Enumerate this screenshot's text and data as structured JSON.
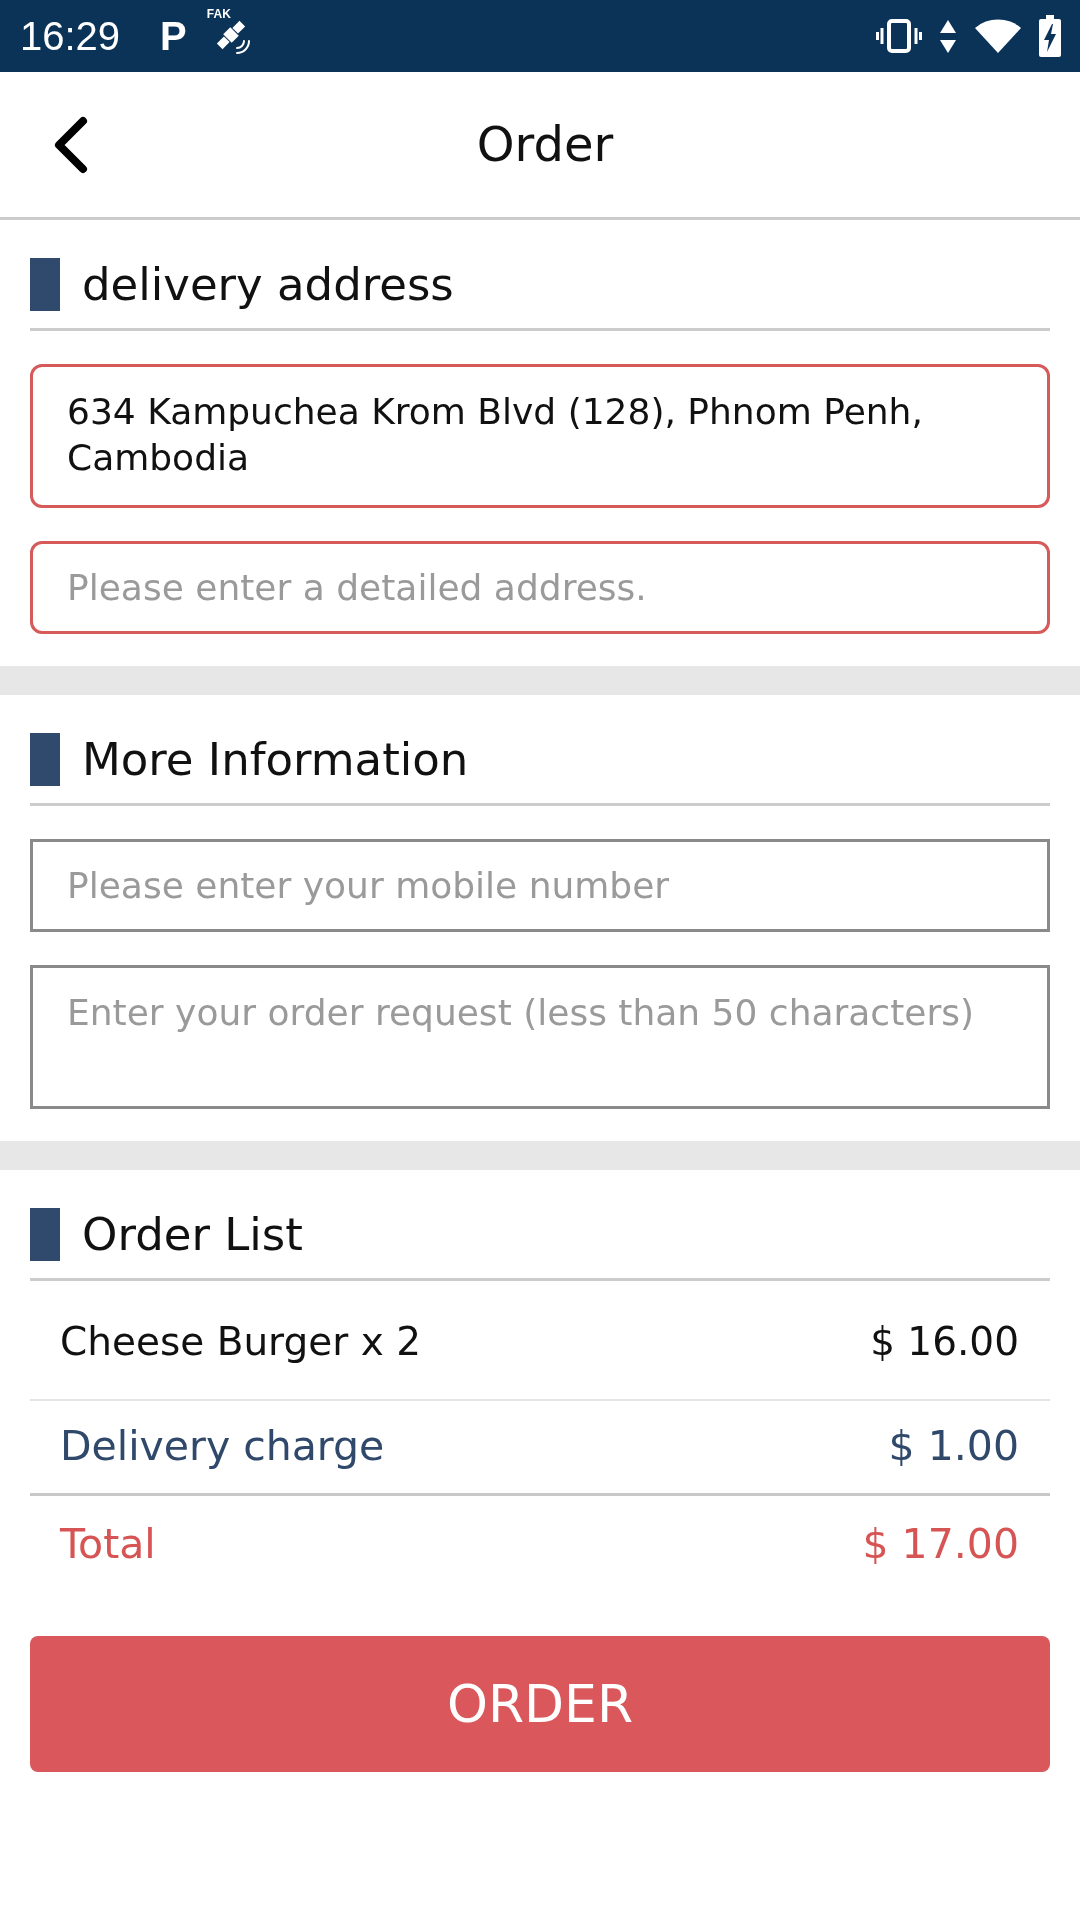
{
  "status_bar": {
    "time": "16:29",
    "app_letter": "P",
    "gps_label": "FAK"
  },
  "header": {
    "title": "Order"
  },
  "sections": [
    {
      "title": "delivery address",
      "fields": [
        {
          "kind": "textarea",
          "value": "634 Kampuchea Krom Blvd (128), Phnom Penh, Cambodia",
          "highlighted": true
        },
        {
          "kind": "input",
          "placeholder": "Please enter a detailed address.",
          "highlighted": true
        }
      ]
    },
    {
      "title": "More Information",
      "fields": [
        {
          "kind": "input",
          "placeholder": "Please enter your mobile number",
          "highlighted": false
        },
        {
          "kind": "textarea",
          "placeholder": "Enter your order request (less than 50 characters)",
          "highlighted": false
        }
      ]
    },
    {
      "title": "Order List",
      "rows": [
        {
          "kind": "item",
          "label": "Cheese Burger x 2",
          "amount": "$ 16.00"
        },
        {
          "kind": "fee",
          "label": "Delivery charge",
          "amount": "$ 1.00"
        },
        {
          "kind": "total",
          "label": "Total",
          "amount": "$ 17.00"
        }
      ]
    }
  ],
  "order_button": {
    "label": "ORDER"
  }
}
